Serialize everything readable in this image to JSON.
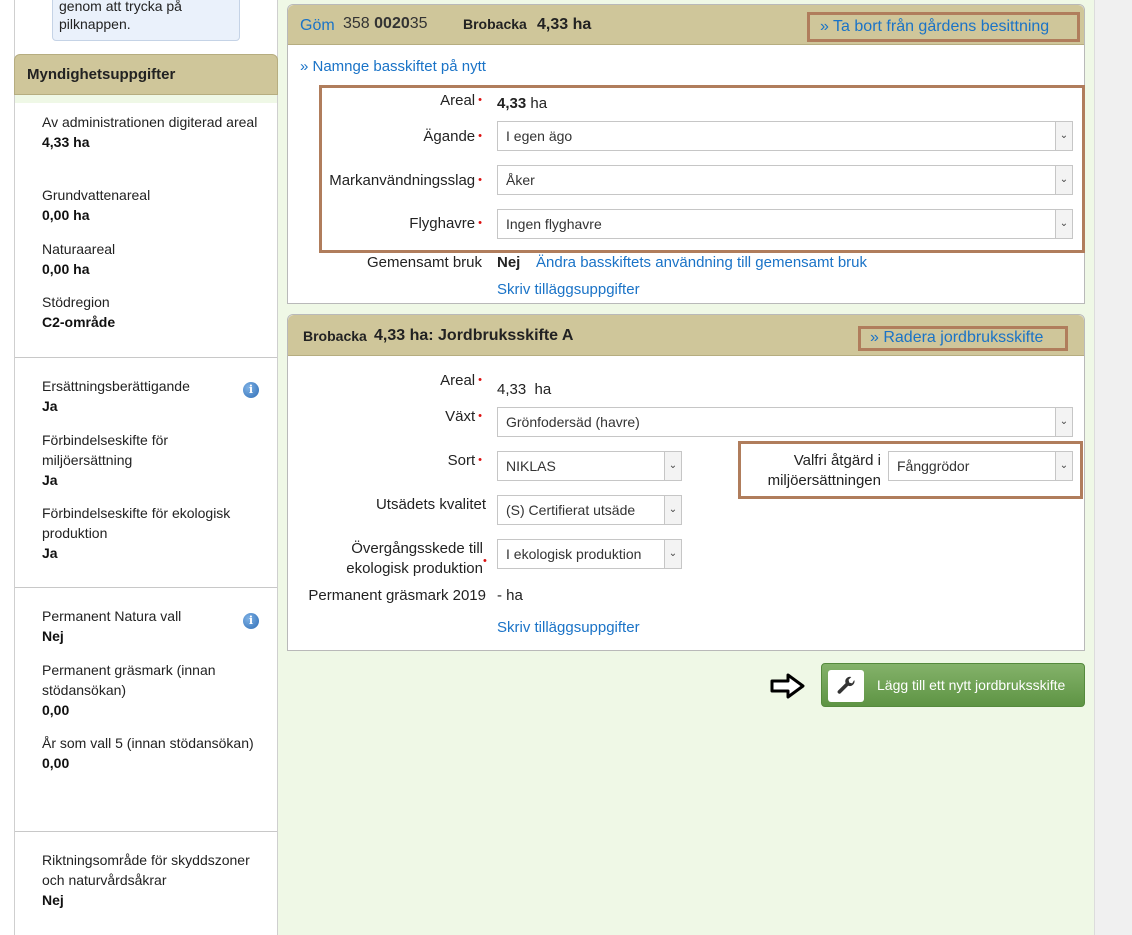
{
  "left": {
    "info_box_text": "genom att trycka på pilknappen.",
    "myndighet_header": "Myndighetsuppgifter",
    "myndighet_items": [
      {
        "label": "Av administrationen digiterad areal",
        "value": "4,33 ha"
      },
      {
        "label": "Grundvattenareal",
        "value": "0,00 ha"
      },
      {
        "label": "Naturaareal",
        "value": "0,00 ha"
      },
      {
        "label": "Stödregion",
        "value": "C2-område"
      }
    ],
    "section2": [
      {
        "label": "Ersättningsberättigande",
        "value": "Ja"
      },
      {
        "label": "Förbindelseskifte för miljöersättning",
        "value": "Ja"
      },
      {
        "label": "Förbindelseskifte för ekologisk produktion",
        "value": "Ja"
      }
    ],
    "section3": [
      {
        "label": "Permanent Natura vall",
        "value": "Nej"
      },
      {
        "label": "Permanent gräsmark (innan stödansökan)",
        "value": "0,00"
      },
      {
        "label": "År som vall 5 (innan stödansökan)",
        "value": "0,00"
      }
    ],
    "section4": [
      {
        "label": "Riktningsområde för skyddszoner och naturvårdsåkrar",
        "value": "Nej"
      }
    ],
    "info_icon_glyph": "i"
  },
  "basskifte": {
    "hide_link": "Göm",
    "block_id_prefix": "358",
    "block_id_mid": "0020",
    "block_id_suffix": "35",
    "name": "Brobacka",
    "area_header": "4,33 ha",
    "remove_link": "» Ta bort från gårdens besittning",
    "rename_link": "» Namnge basskiftet på nytt",
    "fields": {
      "areal_label": "Areal",
      "areal_value": "4,33",
      "areal_unit": "ha",
      "agande_label": "Ägande",
      "agande_value": "I egen ägo",
      "mark_label": "Markanvändningsslag",
      "mark_value": "Åker",
      "flyghavre_label": "Flyghavre",
      "flyghavre_value": "Ingen flyghavre"
    },
    "gemensamt_label": "Gemensamt bruk",
    "gemensamt_value": "Nej",
    "gemensamt_link": "Ändra basskiftets användning till gemensamt bruk",
    "extra_link": "Skriv tilläggsuppgifter"
  },
  "jordbruksskifte": {
    "name": "Brobacka",
    "title": "4,33 ha: Jordbruksskifte A",
    "delete_link": "» Radera jordbruksskifte",
    "areal_label": "Areal",
    "areal_value": "4,33",
    "areal_unit": "ha",
    "vaxt_label": "Växt",
    "vaxt_value": "Grönfodersäd (havre)",
    "sort_label": "Sort",
    "sort_value": "NIKLAS",
    "valfri_label_1": "Valfri åtgärd i",
    "valfri_label_2": "miljöersättningen",
    "valfri_value": "Fånggrödor",
    "utsade_label": "Utsädets kvalitet",
    "utsade_value": "(S) Certifierat utsäde",
    "overgang_label_1": "Övergångsskede till",
    "overgang_label_2": "ekologisk produktion",
    "overgang_value": "I ekologisk produktion",
    "perm_label": "Permanent gräsmark 2019",
    "perm_value": "- ha",
    "extra_link": "Skriv tilläggsuppgifter"
  },
  "add_button_label": "Lägg till ett nytt jordbruksskifte",
  "icons": {
    "select_arrow": "⌄",
    "wrench": "🔧",
    "required_mark": "•"
  },
  "colors": {
    "header_bg": "#cfc69a",
    "highlight_border": "#b07d5c",
    "link": "#1a73c7",
    "button_green": "#6fa356",
    "page_bg": "#eff8e6"
  }
}
